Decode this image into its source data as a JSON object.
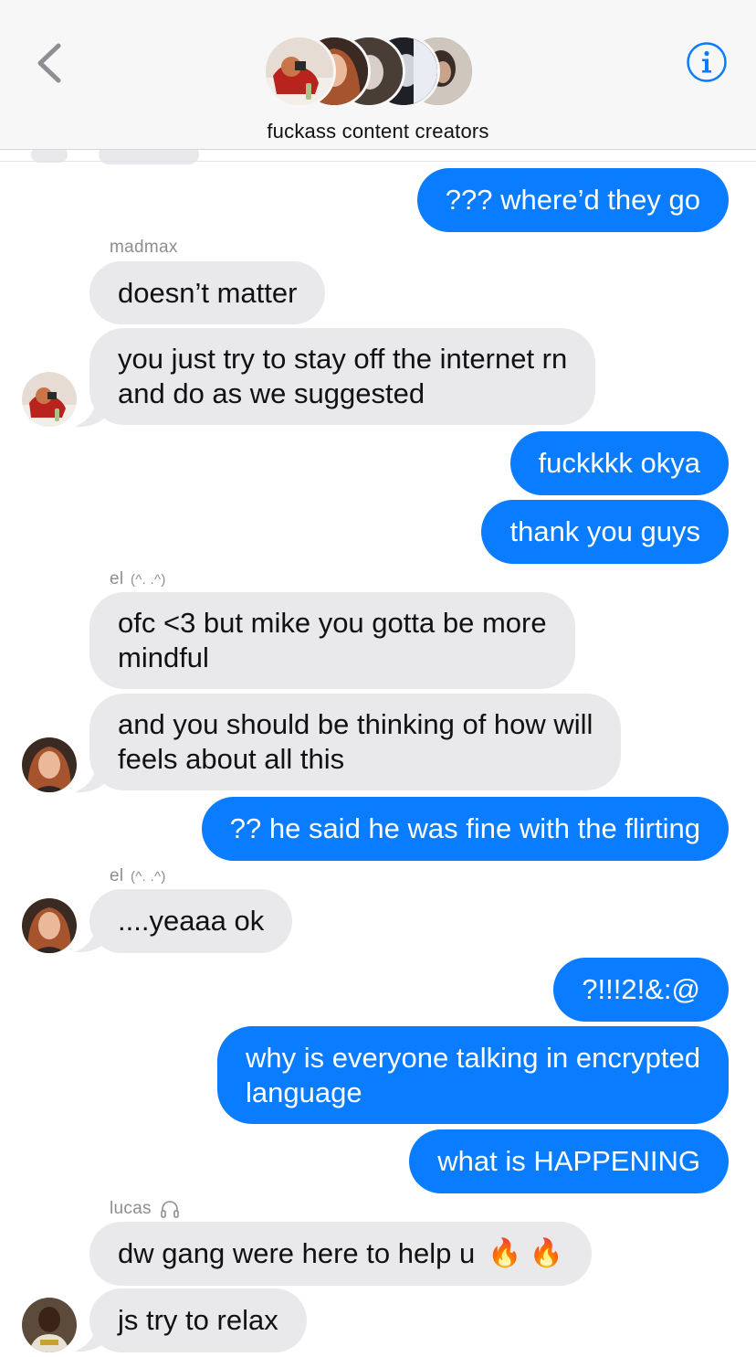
{
  "header": {
    "group_name": "fuckass content creators"
  },
  "messages": [
    {
      "dir": "out",
      "text": "??? where’d they go"
    },
    {
      "dir": "sender",
      "text": "madmax"
    },
    {
      "dir": "in",
      "text": "doesn’t matter"
    },
    {
      "dir": "in",
      "lines": [
        "you just try to stay off the internet rn",
        "and do as we suggested"
      ]
    },
    {
      "dir": "out",
      "text": "fuckkkk okya"
    },
    {
      "dir": "out",
      "text": "thank you guys"
    },
    {
      "dir": "sender",
      "text": "el",
      "suffix": "(^. .^)"
    },
    {
      "dir": "in",
      "lines": [
        "ofc <3 but mike you gotta be more",
        "mindful"
      ]
    },
    {
      "dir": "in",
      "lines": [
        "and you should be thinking of how will",
        "feels about all this"
      ]
    },
    {
      "dir": "out",
      "text": "?? he said he was fine with the flirting"
    },
    {
      "dir": "sender",
      "text": "el",
      "suffix": "(^. .^)"
    },
    {
      "dir": "in",
      "text": "....yeaaa ok"
    },
    {
      "dir": "out",
      "text": "?!!!2!&:@"
    },
    {
      "dir": "out",
      "lines": [
        "why is everyone talking in encrypted",
        "language"
      ]
    },
    {
      "dir": "out",
      "text": "what is HAPPENING"
    },
    {
      "dir": "sender",
      "text": "lucas",
      "icon": "headphones-icon"
    },
    {
      "dir": "in",
      "text": "dw gang were here to help u",
      "emoji": "🔥 🔥"
    },
    {
      "dir": "in",
      "text": "js try to relax"
    }
  ],
  "colors": {
    "outgoing_bubble": "#0a7cff",
    "incoming_bubble": "#e9e9eb",
    "accent": "#0a7cff",
    "sender_label": "#8e8e93"
  },
  "icons": [
    "back-chevron-icon",
    "info-icon",
    "headphones-icon",
    "fire-emoji"
  ]
}
